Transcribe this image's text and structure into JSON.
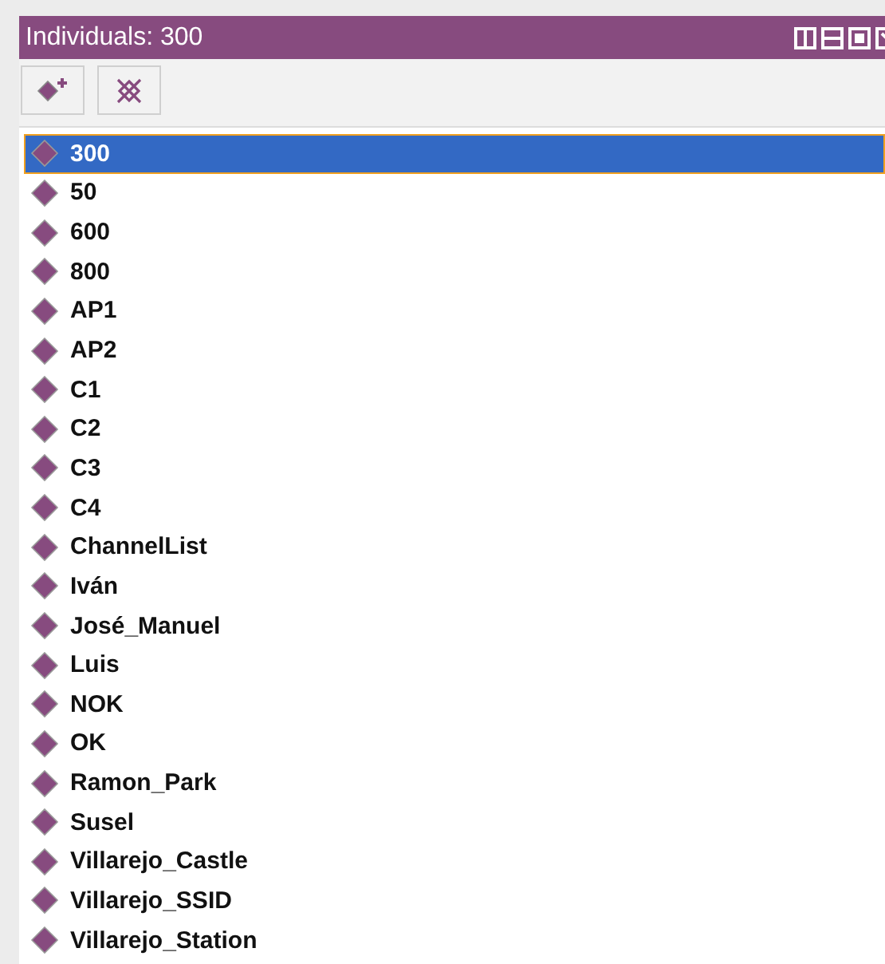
{
  "panel": {
    "title": "Individuals: 300"
  },
  "toolbar": [
    {
      "kind": "add"
    },
    {
      "kind": "delete"
    }
  ],
  "individuals": [
    {
      "name": "300",
      "selected": true
    },
    {
      "name": "50",
      "selected": false
    },
    {
      "name": "600",
      "selected": false
    },
    {
      "name": "800",
      "selected": false
    },
    {
      "name": "AP1",
      "selected": false
    },
    {
      "name": "AP2",
      "selected": false
    },
    {
      "name": "C1",
      "selected": false
    },
    {
      "name": "C2",
      "selected": false
    },
    {
      "name": "C3",
      "selected": false
    },
    {
      "name": "C4",
      "selected": false
    },
    {
      "name": "ChannelList",
      "selected": false
    },
    {
      "name": "Iván",
      "selected": false
    },
    {
      "name": "José_Manuel",
      "selected": false
    },
    {
      "name": "Luis",
      "selected": false
    },
    {
      "name": "NOK",
      "selected": false
    },
    {
      "name": "OK",
      "selected": false
    },
    {
      "name": "Ramon_Park",
      "selected": false
    },
    {
      "name": "Susel",
      "selected": false
    },
    {
      "name": "Villarejo_Castle",
      "selected": false
    },
    {
      "name": "Villarejo_SSID",
      "selected": false
    },
    {
      "name": "Villarejo_Station",
      "selected": false
    }
  ]
}
